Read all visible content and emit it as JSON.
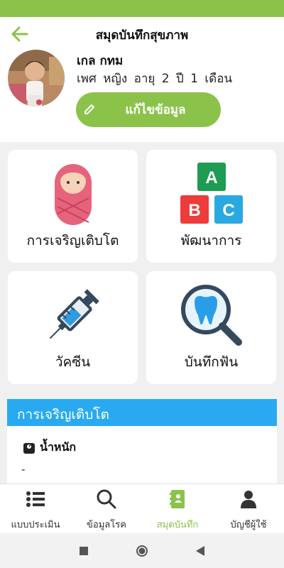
{
  "header": {
    "title": "สมุดบันทึกสุขภาพ",
    "back_icon": "arrow-left-icon",
    "accent_color": "#8bc34a"
  },
  "profile": {
    "name": "เกล กทม",
    "info": "เพศ หญิง อายุ 2 ปี 1 เดือน",
    "edit_label": "แก้ไขข้อมูล"
  },
  "menu": {
    "growth": {
      "label": "การเจริญเติบโต",
      "icon": "swaddled-baby-icon"
    },
    "development": {
      "label": "พัฒนาการ",
      "icon": "abc-blocks-icon",
      "blocks": [
        "A",
        "B",
        "C"
      ]
    },
    "vaccine": {
      "label": "วัคซีน",
      "icon": "syringe-icon"
    },
    "dental": {
      "label": "บันทึกฟัน",
      "icon": "tooth-magnifier-icon"
    }
  },
  "growth_section": {
    "title": "การเจริญเติบโต",
    "header_color": "#29aaf0",
    "weight_label": "น้ำหนัก",
    "weight_value": "-"
  },
  "bottom_nav": [
    {
      "label": "แบบประเมิน",
      "icon": "list-icon",
      "active": false
    },
    {
      "label": "ข้อมูลโรค",
      "icon": "search-icon",
      "active": false
    },
    {
      "label": "สมุดบันทึก",
      "icon": "notebook-icon",
      "active": true
    },
    {
      "label": "บัญชีผู้ใช้",
      "icon": "user-icon",
      "active": false
    }
  ],
  "system_nav": [
    "square-icon",
    "circle-icon",
    "triangle-back-icon"
  ]
}
